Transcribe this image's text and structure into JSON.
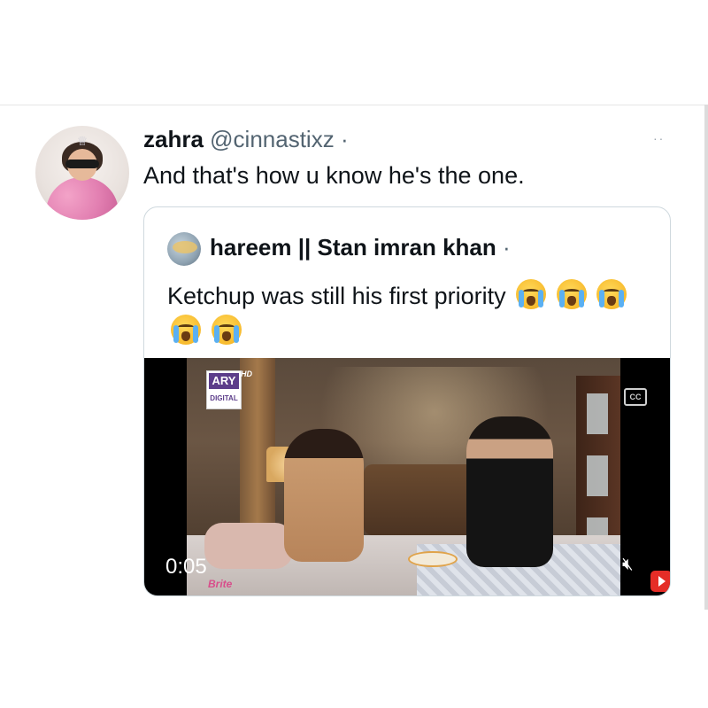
{
  "tweet": {
    "author_name": "zahra",
    "author_handle": "@cinnastixz",
    "separator": "·",
    "text": "And that's how u know he's the one.",
    "more_icon": "ellipsis-icon"
  },
  "quote": {
    "author_name": "hareem || Stan imran khan",
    "separator": "·",
    "text": "Ketchup was still his first priority",
    "emoji_icon": "loudly-crying-face-emoji",
    "emoji_count": 5
  },
  "video": {
    "channel_logo": "ARY",
    "channel_logo_tag": "HD",
    "channel_logo_sub": "DIGITAL",
    "cc_label": "CC",
    "timestamp": "0:05",
    "mute_icon": "speaker-muted-icon",
    "sponsor_text": "Brite",
    "youtube_icon": "youtube-subscribe-icon"
  },
  "colors": {
    "text_primary": "#0f1419",
    "text_secondary": "#536471",
    "card_border": "#cfd9de"
  }
}
